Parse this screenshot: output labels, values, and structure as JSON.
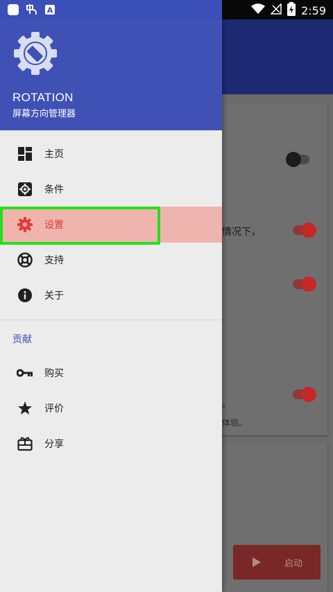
{
  "status_bar": {
    "time": "2:59",
    "left_icons": [
      "app-square-icon",
      "bug-notification-icon",
      "a-notification-icon"
    ],
    "right_icons": [
      "wifi-icon",
      "no-signal-icon",
      "battery-charging-icon"
    ]
  },
  "drawer": {
    "header": {
      "title": "ROTATION",
      "subtitle": "屏幕方向管理器"
    },
    "items": [
      {
        "label": "主页",
        "icon": "dashboard-icon"
      },
      {
        "label": "条件",
        "icon": "conditions-gear-icon"
      },
      {
        "label": "设置",
        "icon": "settings-gear-icon",
        "selected": true
      },
      {
        "label": "支持",
        "icon": "lifebuoy-icon"
      },
      {
        "label": "关于",
        "icon": "info-icon"
      }
    ],
    "section_title": "贡献",
    "contribute_items": [
      {
        "label": "购买",
        "icon": "key-icon"
      },
      {
        "label": "评价",
        "icon": "star-icon"
      },
      {
        "label": "分享",
        "icon": "gift-share-icon"
      }
    ]
  },
  "background": {
    "card1_text_1": "情况下，",
    "card1_text_2": "。",
    "card1_text_3": "体验。",
    "start_button": "启动"
  },
  "colors": {
    "primary": "#3f51b5",
    "accent": "#e53935",
    "selected_bg": "#f0b4ae",
    "highlight": "#22e01a"
  }
}
